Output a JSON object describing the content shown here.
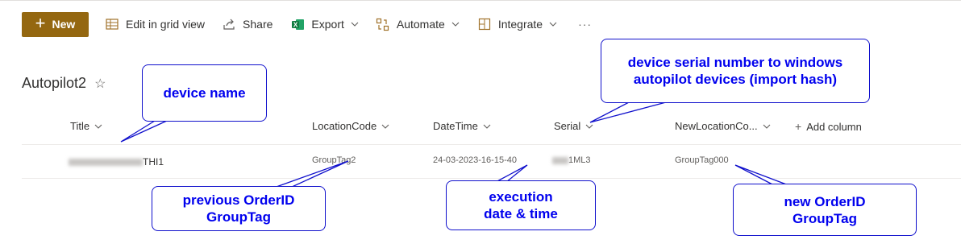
{
  "toolbar": {
    "new_label": "New",
    "edit_grid_label": "Edit in grid view",
    "share_label": "Share",
    "export_label": "Export",
    "automate_label": "Automate",
    "integrate_label": "Integrate",
    "more_label": "···"
  },
  "list": {
    "title": "Autopilot2",
    "add_column_label": "Add column",
    "columns": [
      "Title",
      "LocationCode",
      "DateTime",
      "Serial",
      "NewLocationCo..."
    ],
    "row": {
      "title_suffix": "THI1",
      "location_code": "GroupTag2",
      "datetime": "24-03-2023-16-15-40",
      "serial_suffix": "1ML3",
      "new_location_code": "GroupTag000"
    }
  },
  "annotations": {
    "device_name": "device name",
    "serial_line1": "device serial number to windows",
    "serial_line2": "autopilot devices (import hash)",
    "previous_line1": "previous OrderID",
    "previous_line2": "GroupTag",
    "exec_line1": "execution",
    "exec_line2": "date & time",
    "new_line1": "new OrderID",
    "new_line2": "GroupTag"
  },
  "colors": {
    "new_button": "#946710",
    "annotation_text": "#0000ee",
    "annotation_border": "#1010cc"
  }
}
